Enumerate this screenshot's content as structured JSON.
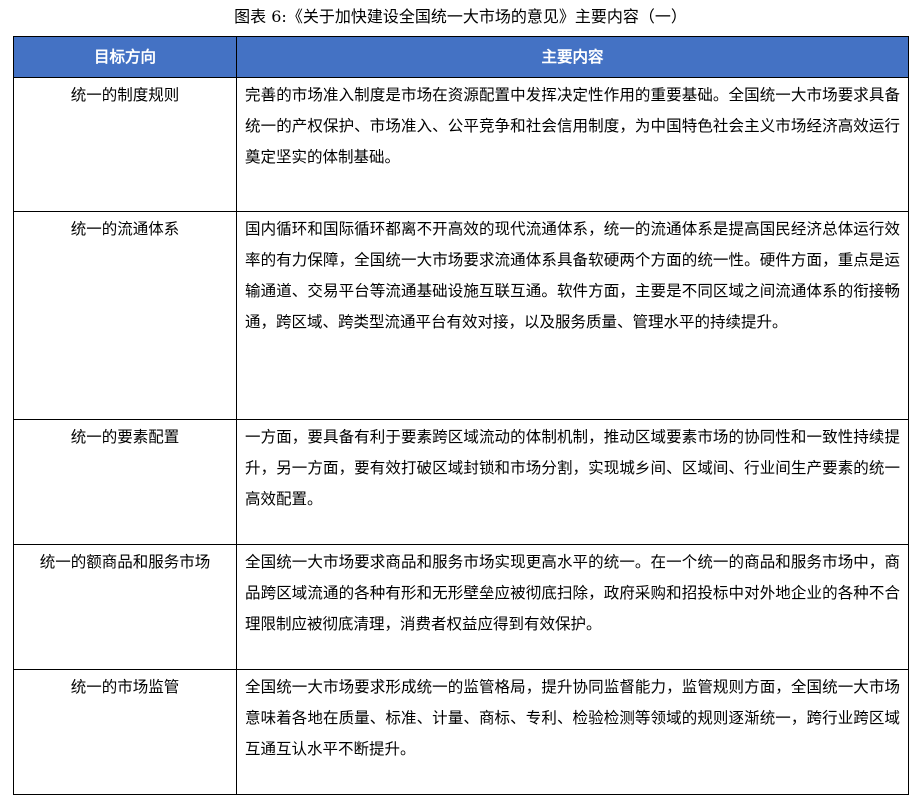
{
  "caption": "图表 6:《关于加快建设全国统一大市场的意见》主要内容（一）",
  "table": {
    "headers": [
      "目标方向",
      "主要内容"
    ],
    "rows": [
      {
        "direction": "统一的制度规则",
        "content": "完善的市场准入制度是市场在资源配置中发挥决定性作用的重要基础。全国统一大市场要求具备统一的产权保护、市场准入、公平竞争和社会信用制度，为中国特色社会主义市场经济高效运行奠定坚实的体制基础。"
      },
      {
        "direction": "统一的流通体系",
        "content": "国内循环和国际循环都离不开高效的现代流通体系，统一的流通体系是提高国民经济总体运行效率的有力保障，全国统一大市场要求流通体系具备软硬两个方面的统一性。硬件方面，重点是运输通道、交易平台等流通基础设施互联互通。软件方面，主要是不同区域之间流通体系的衔接畅通，跨区域、跨类型流通平台有效对接，以及服务质量、管理水平的持续提升。"
      },
      {
        "direction": "统一的要素配置",
        "content": "一方面，要具备有利于要素跨区域流动的体制机制，推动区域要素市场的协同性和一致性持续提升，另一方面，要有效打破区域封锁和市场分割，实现城乡间、区域间、行业间生产要素的统一高效配置。"
      },
      {
        "direction": "统一的额商品和服务市场",
        "content": "全国统一大市场要求商品和服务市场实现更高水平的统一。在一个统一的商品和服务市场中，商品跨区域流通的各种有形和无形壁垒应被彻底扫除，政府采购和招投标中对外地企业的各种不合理限制应被彻底清理，消费者权益应得到有效保护。"
      },
      {
        "direction": "统一的市场监管",
        "content": "全国统一大市场要求形成统一的监管格局，提升协同监督能力，监管规则方面，全国统一大市场意味着各地在质量、标准、计量、商标、专利、检验检测等领域的规则逐渐统一，跨行业跨区域互通互认水平不断提升。"
      }
    ]
  },
  "colors": {
    "header_background": "#4472c4",
    "header_text": "#ffffff",
    "border": "#000000"
  }
}
